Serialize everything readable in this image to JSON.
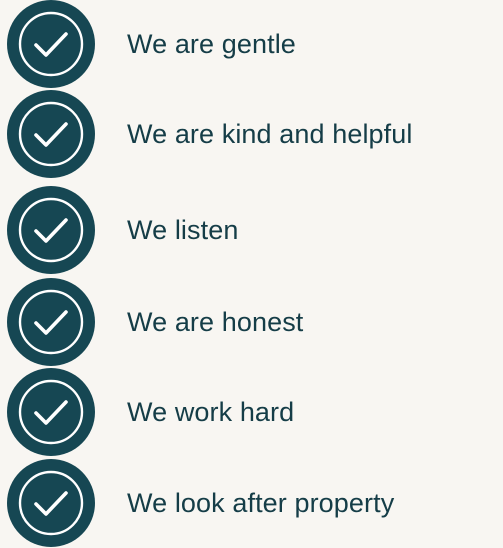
{
  "colors": {
    "background": "#f8f6f2",
    "badge_fill": "#164753",
    "badge_ring": "#ffffff",
    "check_mark": "#ffffff",
    "text": "#153d47"
  },
  "list": {
    "items": [
      {
        "label": "We are gentle",
        "icon": "check-circle-icon"
      },
      {
        "label": "We are kind and helpful",
        "icon": "check-circle-icon"
      },
      {
        "label": "We listen",
        "icon": "check-circle-icon"
      },
      {
        "label": "We are honest",
        "icon": "check-circle-icon"
      },
      {
        "label": "We work hard",
        "icon": "check-circle-icon"
      },
      {
        "label": "We look after property",
        "icon": "check-circle-icon"
      }
    ]
  }
}
